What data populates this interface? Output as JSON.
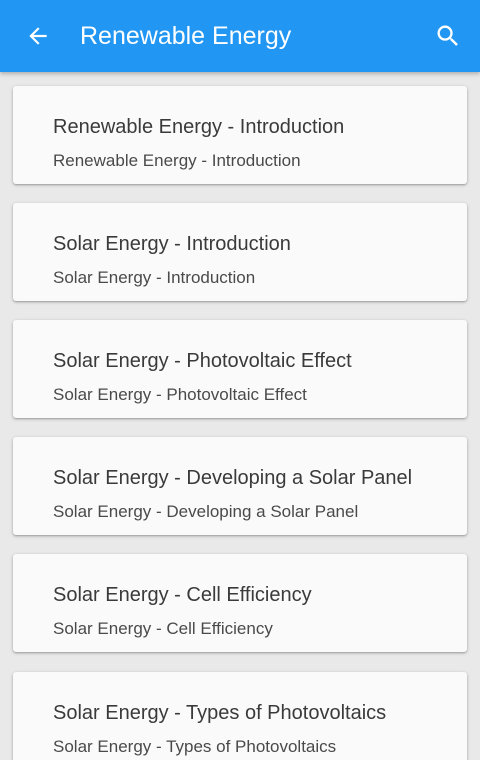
{
  "appbar": {
    "title": "Renewable Energy",
    "back_icon": "arrow-left-icon",
    "search_icon": "search-icon",
    "color": "#2196f3"
  },
  "list": {
    "items": [
      {
        "title": "Renewable Energy - Introduction",
        "subtitle": "Renewable Energy - Introduction"
      },
      {
        "title": "Solar Energy - Introduction",
        "subtitle": "Solar Energy - Introduction"
      },
      {
        "title": "Solar Energy - Photovoltaic Effect",
        "subtitle": "Solar Energy - Photovoltaic Effect"
      },
      {
        "title": "Solar Energy - Developing a Solar Panel",
        "subtitle": "Solar Energy - Developing a Solar Panel"
      },
      {
        "title": "Solar Energy - Cell Efficiency",
        "subtitle": "Solar Energy - Cell Efficiency"
      },
      {
        "title": "Solar Energy - Types of Photovoltaics",
        "subtitle": "Solar Energy - Types of Photovoltaics"
      }
    ]
  }
}
